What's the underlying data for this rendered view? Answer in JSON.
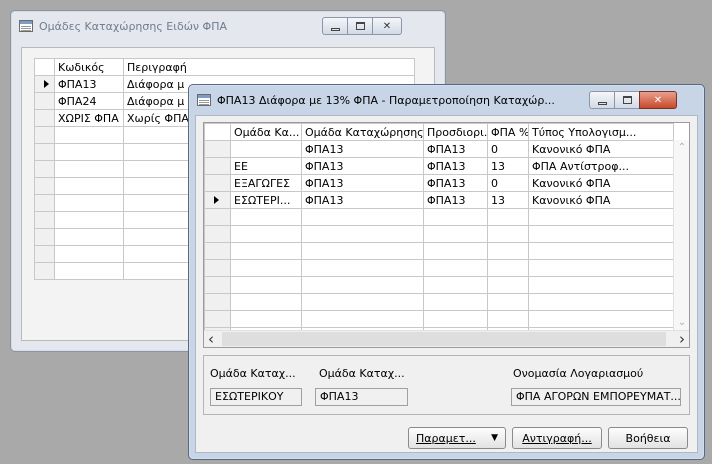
{
  "back_window": {
    "title": "Ομάδες Καταχώρησης Ειδών ΦΠΑ",
    "columns": [
      "Κωδικός",
      "Περιγραφή"
    ],
    "rows": [
      {
        "code": "ΦΠΑ13",
        "desc": "Διάφορα μ",
        "current": true
      },
      {
        "code": "ΦΠΑ24",
        "desc": "Διάφορα μ",
        "current": false
      },
      {
        "code": "ΧΩΡΙΣ ΦΠΑ",
        "desc": "Χωρίς ΦΠΑ",
        "current": false
      }
    ],
    "empty_rows": 9
  },
  "front_window": {
    "title": "ΦΠΑ13 Διάφορα με 13% ΦΠΑ - Παραμετροποίηση Καταχώρ...",
    "columns": [
      "Ομάδα Κα...",
      "Ομάδα Καταχώρησης Ειδών...",
      "Προσδιορι...",
      "ΦΠΑ %",
      "Τύπος Υπολογισμ..."
    ],
    "rows": [
      {
        "c1": "",
        "c2": "ΦΠΑ13",
        "c3": "ΦΠΑ13",
        "c4": "0",
        "c5": "Κανονικό ΦΠΑ",
        "current": false
      },
      {
        "c1": "ΕΕ",
        "c2": "ΦΠΑ13",
        "c3": "ΦΠΑ13",
        "c4": "13",
        "c5": "ΦΠΑ Αντίστροφ...",
        "current": false
      },
      {
        "c1": "ΕΞΑΓΩΓΕΣ",
        "c2": "ΦΠΑ13",
        "c3": "ΦΠΑ13",
        "c4": "0",
        "c5": "Κανονικό ΦΠΑ",
        "current": false
      },
      {
        "c1": "ΕΣΩΤΕΡΙ...",
        "c2": "ΦΠΑ13",
        "c3": "ΦΠΑ13",
        "c4": "13",
        "c5": "Κανονικό ΦΠΑ",
        "current": true
      }
    ],
    "empty_rows": 8,
    "footer": {
      "label1": "Ομάδα Καταχ...",
      "label2": "Ομάδα Καταχ...",
      "label3": "Ονομασία Λογαριασμού",
      "value1": "ΕΣΩΤΕΡΙΚΟΥ",
      "value2": "ΦΠΑ13",
      "value3": "ΦΠΑ ΑΓΟΡΩΝ ΕΜΠΟΡΕΥΜΑΤ..."
    },
    "buttons": {
      "params": "Παραμετ...",
      "copy": "Αντιγραφή...",
      "help": "Βοήθεια"
    }
  },
  "icons": {
    "dropdown": "▼",
    "close": "✕",
    "scroll_left": "‹",
    "scroll_right": "›",
    "scroll_up": "⌃",
    "scroll_down": "⌄"
  }
}
